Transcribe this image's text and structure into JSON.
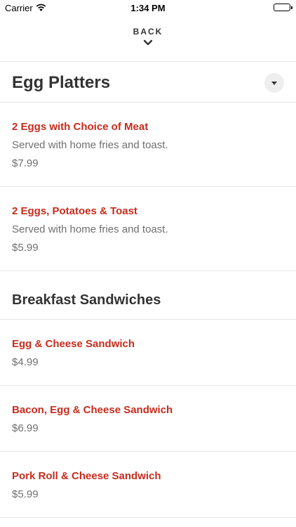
{
  "status_bar": {
    "carrier": "Carrier",
    "time": "1:34 PM",
    "wifi_icon": "wifi-icon",
    "battery_icon": "battery-icon"
  },
  "nav": {
    "back_label": "BACK",
    "back_icon": "chevron-down-icon"
  },
  "sections": [
    {
      "title": "Egg Platters",
      "toggle_icon": "caret-down-icon",
      "items": [
        {
          "name": "2 Eggs with Choice of Meat",
          "description": "Served with home fries and toast.",
          "price": "$7.99"
        },
        {
          "name": "2 Eggs, Potatoes & Toast",
          "description": "Served with home fries and toast.",
          "price": "$5.99"
        }
      ]
    },
    {
      "title": "Breakfast Sandwiches",
      "items": [
        {
          "name": "Egg & Cheese Sandwich",
          "price": "$4.99"
        },
        {
          "name": "Bacon, Egg & Cheese Sandwich",
          "price": "$6.99"
        },
        {
          "name": "Pork Roll & Cheese Sandwich",
          "price": "$5.99"
        }
      ]
    }
  ],
  "colors": {
    "item_name": "#c62c1e",
    "secondary_text": "#707070",
    "divider": "#e6e6e6"
  }
}
